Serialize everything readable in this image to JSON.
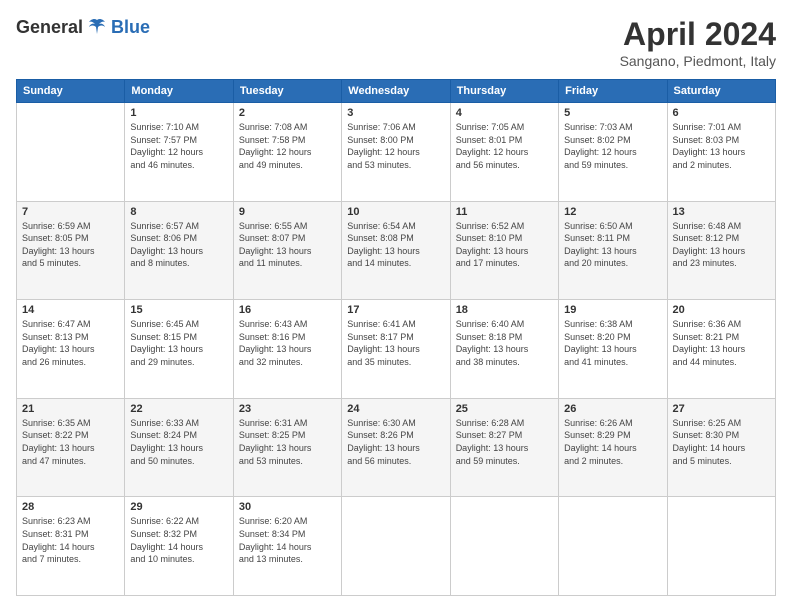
{
  "logo": {
    "general": "General",
    "blue": "Blue"
  },
  "header": {
    "title": "April 2024",
    "location": "Sangano, Piedmont, Italy"
  },
  "days_of_week": [
    "Sunday",
    "Monday",
    "Tuesday",
    "Wednesday",
    "Thursday",
    "Friday",
    "Saturday"
  ],
  "weeks": [
    [
      {
        "day": "",
        "info": ""
      },
      {
        "day": "1",
        "info": "Sunrise: 7:10 AM\nSunset: 7:57 PM\nDaylight: 12 hours\nand 46 minutes."
      },
      {
        "day": "2",
        "info": "Sunrise: 7:08 AM\nSunset: 7:58 PM\nDaylight: 12 hours\nand 49 minutes."
      },
      {
        "day": "3",
        "info": "Sunrise: 7:06 AM\nSunset: 8:00 PM\nDaylight: 12 hours\nand 53 minutes."
      },
      {
        "day": "4",
        "info": "Sunrise: 7:05 AM\nSunset: 8:01 PM\nDaylight: 12 hours\nand 56 minutes."
      },
      {
        "day": "5",
        "info": "Sunrise: 7:03 AM\nSunset: 8:02 PM\nDaylight: 12 hours\nand 59 minutes."
      },
      {
        "day": "6",
        "info": "Sunrise: 7:01 AM\nSunset: 8:03 PM\nDaylight: 13 hours\nand 2 minutes."
      }
    ],
    [
      {
        "day": "7",
        "info": "Sunrise: 6:59 AM\nSunset: 8:05 PM\nDaylight: 13 hours\nand 5 minutes."
      },
      {
        "day": "8",
        "info": "Sunrise: 6:57 AM\nSunset: 8:06 PM\nDaylight: 13 hours\nand 8 minutes."
      },
      {
        "day": "9",
        "info": "Sunrise: 6:55 AM\nSunset: 8:07 PM\nDaylight: 13 hours\nand 11 minutes."
      },
      {
        "day": "10",
        "info": "Sunrise: 6:54 AM\nSunset: 8:08 PM\nDaylight: 13 hours\nand 14 minutes."
      },
      {
        "day": "11",
        "info": "Sunrise: 6:52 AM\nSunset: 8:10 PM\nDaylight: 13 hours\nand 17 minutes."
      },
      {
        "day": "12",
        "info": "Sunrise: 6:50 AM\nSunset: 8:11 PM\nDaylight: 13 hours\nand 20 minutes."
      },
      {
        "day": "13",
        "info": "Sunrise: 6:48 AM\nSunset: 8:12 PM\nDaylight: 13 hours\nand 23 minutes."
      }
    ],
    [
      {
        "day": "14",
        "info": "Sunrise: 6:47 AM\nSunset: 8:13 PM\nDaylight: 13 hours\nand 26 minutes."
      },
      {
        "day": "15",
        "info": "Sunrise: 6:45 AM\nSunset: 8:15 PM\nDaylight: 13 hours\nand 29 minutes."
      },
      {
        "day": "16",
        "info": "Sunrise: 6:43 AM\nSunset: 8:16 PM\nDaylight: 13 hours\nand 32 minutes."
      },
      {
        "day": "17",
        "info": "Sunrise: 6:41 AM\nSunset: 8:17 PM\nDaylight: 13 hours\nand 35 minutes."
      },
      {
        "day": "18",
        "info": "Sunrise: 6:40 AM\nSunset: 8:18 PM\nDaylight: 13 hours\nand 38 minutes."
      },
      {
        "day": "19",
        "info": "Sunrise: 6:38 AM\nSunset: 8:20 PM\nDaylight: 13 hours\nand 41 minutes."
      },
      {
        "day": "20",
        "info": "Sunrise: 6:36 AM\nSunset: 8:21 PM\nDaylight: 13 hours\nand 44 minutes."
      }
    ],
    [
      {
        "day": "21",
        "info": "Sunrise: 6:35 AM\nSunset: 8:22 PM\nDaylight: 13 hours\nand 47 minutes."
      },
      {
        "day": "22",
        "info": "Sunrise: 6:33 AM\nSunset: 8:24 PM\nDaylight: 13 hours\nand 50 minutes."
      },
      {
        "day": "23",
        "info": "Sunrise: 6:31 AM\nSunset: 8:25 PM\nDaylight: 13 hours\nand 53 minutes."
      },
      {
        "day": "24",
        "info": "Sunrise: 6:30 AM\nSunset: 8:26 PM\nDaylight: 13 hours\nand 56 minutes."
      },
      {
        "day": "25",
        "info": "Sunrise: 6:28 AM\nSunset: 8:27 PM\nDaylight: 13 hours\nand 59 minutes."
      },
      {
        "day": "26",
        "info": "Sunrise: 6:26 AM\nSunset: 8:29 PM\nDaylight: 14 hours\nand 2 minutes."
      },
      {
        "day": "27",
        "info": "Sunrise: 6:25 AM\nSunset: 8:30 PM\nDaylight: 14 hours\nand 5 minutes."
      }
    ],
    [
      {
        "day": "28",
        "info": "Sunrise: 6:23 AM\nSunset: 8:31 PM\nDaylight: 14 hours\nand 7 minutes."
      },
      {
        "day": "29",
        "info": "Sunrise: 6:22 AM\nSunset: 8:32 PM\nDaylight: 14 hours\nand 10 minutes."
      },
      {
        "day": "30",
        "info": "Sunrise: 6:20 AM\nSunset: 8:34 PM\nDaylight: 14 hours\nand 13 minutes."
      },
      {
        "day": "",
        "info": ""
      },
      {
        "day": "",
        "info": ""
      },
      {
        "day": "",
        "info": ""
      },
      {
        "day": "",
        "info": ""
      }
    ]
  ]
}
